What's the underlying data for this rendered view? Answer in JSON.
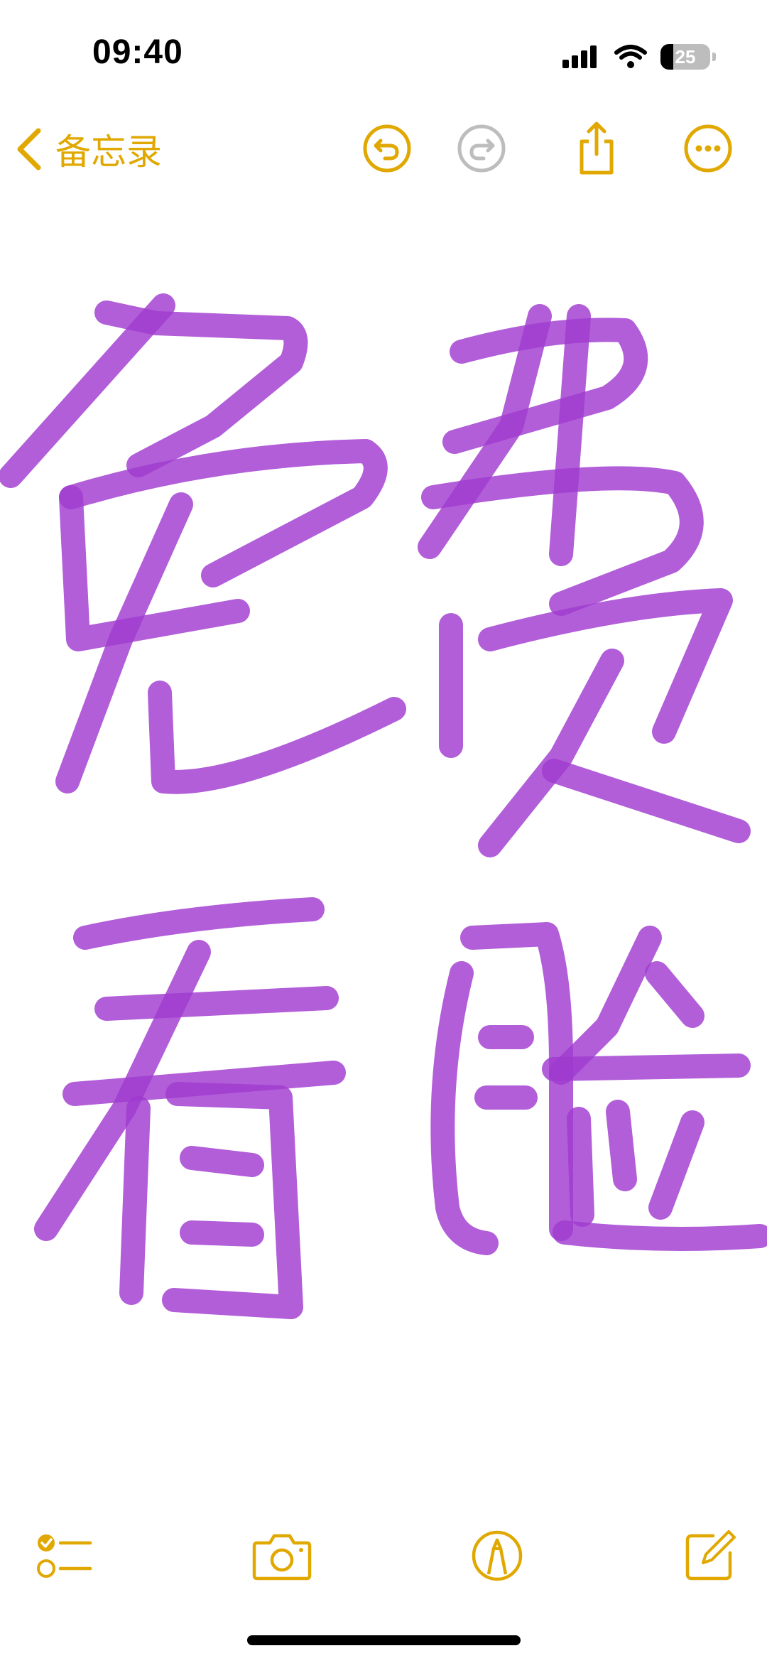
{
  "status_bar": {
    "time": "09:40",
    "battery_level": "25"
  },
  "nav": {
    "back_label": "备忘录",
    "icons": [
      "chevron-left-icon",
      "undo-icon",
      "redo-icon",
      "share-icon",
      "more-icon"
    ]
  },
  "drawing": {
    "description_color": "#a03bd0",
    "strokes_count_visible": 4
  },
  "toolbar": {
    "icons": [
      "checklist-icon",
      "camera-icon",
      "markup-pen-icon",
      "compose-icon"
    ]
  },
  "colors": {
    "accent": "#e0a800",
    "disabled": "#bdbdbd",
    "ink": "#a03bd0"
  }
}
